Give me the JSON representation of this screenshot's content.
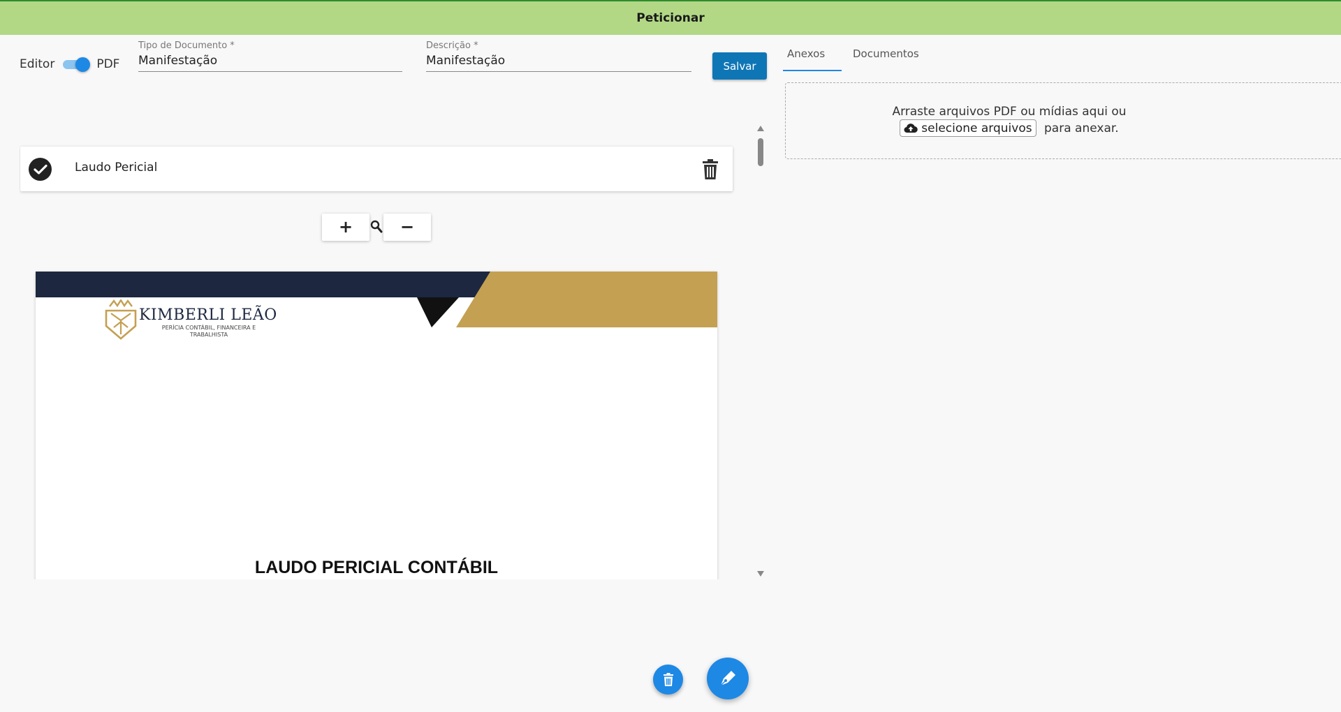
{
  "header": {
    "title": "Peticionar"
  },
  "editor": {
    "toggle_left": "Editor",
    "toggle_right": "PDF",
    "doc_type_label": "Tipo de Documento *",
    "doc_type_value": "Manifestação",
    "description_label": "Descrição *",
    "description_value": "Manifestação",
    "save_label": "Salvar"
  },
  "document": {
    "name": "Laudo Pericial",
    "zoom_in": "+",
    "zoom_out": "−"
  },
  "pdf": {
    "logo_name": "KIMBERLI LEÃO",
    "logo_sub": "PERÍCIA CONTÁBIL, FINANCEIRA E TRABALHISTA",
    "heading": "LAUDO PERICIAL CONTÁBIL",
    "colors": {
      "navy": "#1d2740",
      "gold": "#c4a052"
    }
  },
  "attachments": {
    "tabs": [
      {
        "label": "Anexos"
      },
      {
        "label": "Documentos"
      }
    ],
    "drop_line1": "Arraste arquivos PDF ou mídias aqui ou",
    "select_label": "selecione arquivos",
    "drop_line2_suffix": "para anexar."
  },
  "colors": {
    "accent": "#1e88e5",
    "header_bg": "#b2d886",
    "save_bg": "#0f76b6"
  }
}
